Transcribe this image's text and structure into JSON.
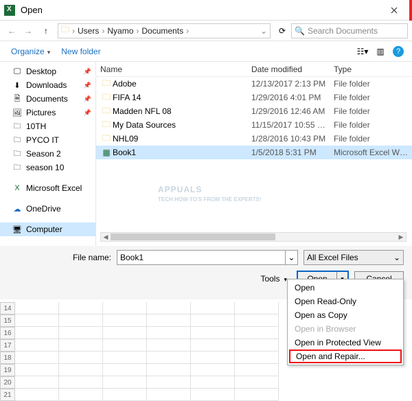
{
  "title": "Open",
  "breadcrumb": {
    "root": "Users",
    "p1": "Nyamo",
    "p2": "Documents"
  },
  "search_placeholder": "Search Documents",
  "toolbar": {
    "organize": "Organize",
    "newfolder": "New folder"
  },
  "columns": {
    "name": "Name",
    "date": "Date modified",
    "type": "Type"
  },
  "sidebar": {
    "desktop": "Desktop",
    "downloads": "Downloads",
    "documents": "Documents",
    "pictures": "Pictures",
    "f10th": "10TH",
    "pyco": "PYCO IT",
    "s2": "Season 2",
    "s10": "season 10",
    "excel": "Microsoft Excel",
    "onedrive": "OneDrive",
    "computer": "Computer"
  },
  "files": {
    "adobe": {
      "name": "Adobe",
      "date": "12/13/2017 2:13 PM",
      "type": "File folder"
    },
    "fifa": {
      "name": "FIFA 14",
      "date": "1/29/2016 4:01 PM",
      "type": "File folder"
    },
    "madden": {
      "name": "Madden NFL 08",
      "date": "1/29/2016 12:46 AM",
      "type": "File folder"
    },
    "mds": {
      "name": "My Data Sources",
      "date": "11/15/2017 10:55 …",
      "type": "File folder"
    },
    "nhl": {
      "name": "NHL09",
      "date": "1/28/2016 10:43 PM",
      "type": "File folder"
    },
    "book1": {
      "name": "Book1",
      "date": "1/5/2018 5:31 PM",
      "type": "Microsoft Excel W…"
    }
  },
  "filename_label": "File name:",
  "filename_value": "Book1",
  "filter_label": "All Excel Files",
  "tools_label": "Tools",
  "open_btn": "Open",
  "cancel_btn": "Cancel",
  "menu": {
    "open": "Open",
    "ro": "Open Read-Only",
    "copy": "Open as Copy",
    "browser": "Open in Browser",
    "protected": "Open in Protected View",
    "repair": "Open and Repair..."
  },
  "grid_rows": [
    "14",
    "15",
    "16",
    "17",
    "18",
    "19",
    "20",
    "21"
  ],
  "watermark": {
    "big": "APPUALS",
    "small": "TECH HOW-TO'S FROM THE EXPERTS!"
  }
}
